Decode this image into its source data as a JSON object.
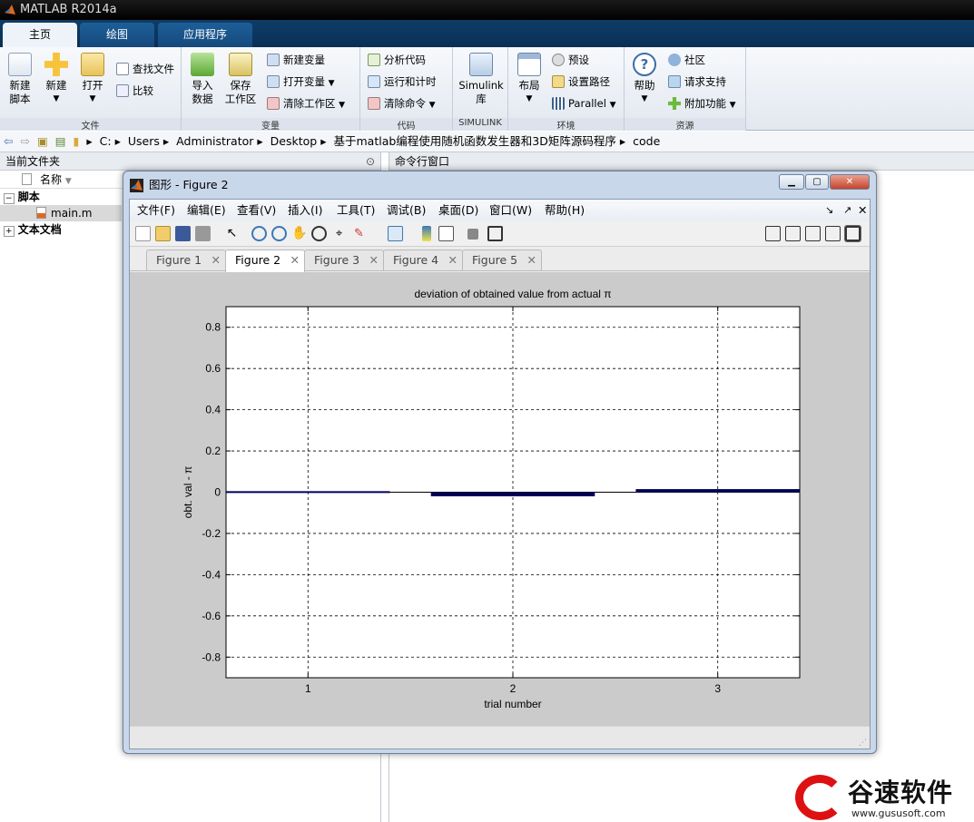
{
  "app": {
    "title": "MATLAB R2014a"
  },
  "ribbon_tabs": [
    "主页",
    "绘图",
    "应用程序"
  ],
  "ribbon": {
    "file": {
      "label": "文件",
      "new_script": [
        "新建",
        "脚本"
      ],
      "new": "新建",
      "open": "打开",
      "find_files": "查找文件",
      "compare": "比较"
    },
    "variable": {
      "label": "变量",
      "import": [
        "导入",
        "数据"
      ],
      "save": [
        "保存",
        "工作区"
      ],
      "new_var": "新建变量",
      "open_var": "打开变量",
      "clear_ws": "清除工作区"
    },
    "code": {
      "label": "代码",
      "analyze": "分析代码",
      "run_time": "运行和计时",
      "clear_cmd": "清除命令"
    },
    "simulink": {
      "label": "SIMULINK",
      "btn": [
        "Simulink",
        "库"
      ]
    },
    "env": {
      "label": "环境",
      "layout": "布局",
      "prefs": "预设",
      "set_path": "设置路径",
      "parallel": "Parallel"
    },
    "resources": {
      "label": "资源",
      "help": "帮助",
      "community": "社区",
      "support": "请求支持",
      "addons": "附加功能"
    }
  },
  "address": [
    "C:",
    "Users",
    "Administrator",
    "Desktop",
    "基于matlab编程使用随机函数发生器和3D矩阵源码程序",
    "code"
  ],
  "left_pane": {
    "title": "当前文件夹",
    "col_name": "名称",
    "folder1": "脚本",
    "file1": "main.m",
    "folder2": "文本文档"
  },
  "cmd_pane": {
    "title": "命令行窗口"
  },
  "figure": {
    "window_title": "图形 - Figure 2",
    "menus": [
      "文件(F)",
      "编辑(E)",
      "查看(V)",
      "插入(I)",
      "工具(T)",
      "调试(B)",
      "桌面(D)",
      "窗口(W)",
      "帮助(H)"
    ],
    "tabs": [
      "Figure 1",
      "Figure 2",
      "Figure 3",
      "Figure 4",
      "Figure 5"
    ],
    "active_tab": 1
  },
  "chart_data": {
    "type": "bar",
    "title": "deviation of obtained value from actual π",
    "xlabel": "trial number",
    "ylabel": "obt. val - π",
    "categories": [
      "1",
      "2",
      "3"
    ],
    "values": [
      0.005,
      -0.02,
      0.015
    ],
    "xlim": [
      0.6,
      3.4
    ],
    "ylim": [
      -0.9,
      0.9
    ],
    "yticks": [
      -0.8,
      -0.6,
      -0.4,
      -0.2,
      0,
      0.2,
      0.4,
      0.6,
      0.8
    ],
    "ytick_labels": [
      "-0.8",
      "-0.6",
      "-0.4",
      "-0.2",
      "0",
      "0.2",
      "0.4",
      "0.6",
      "0.8"
    ],
    "grid": true,
    "bar_color": "#00005a"
  },
  "watermark": {
    "text": "谷速软件",
    "url": "www.gususoft.com"
  }
}
